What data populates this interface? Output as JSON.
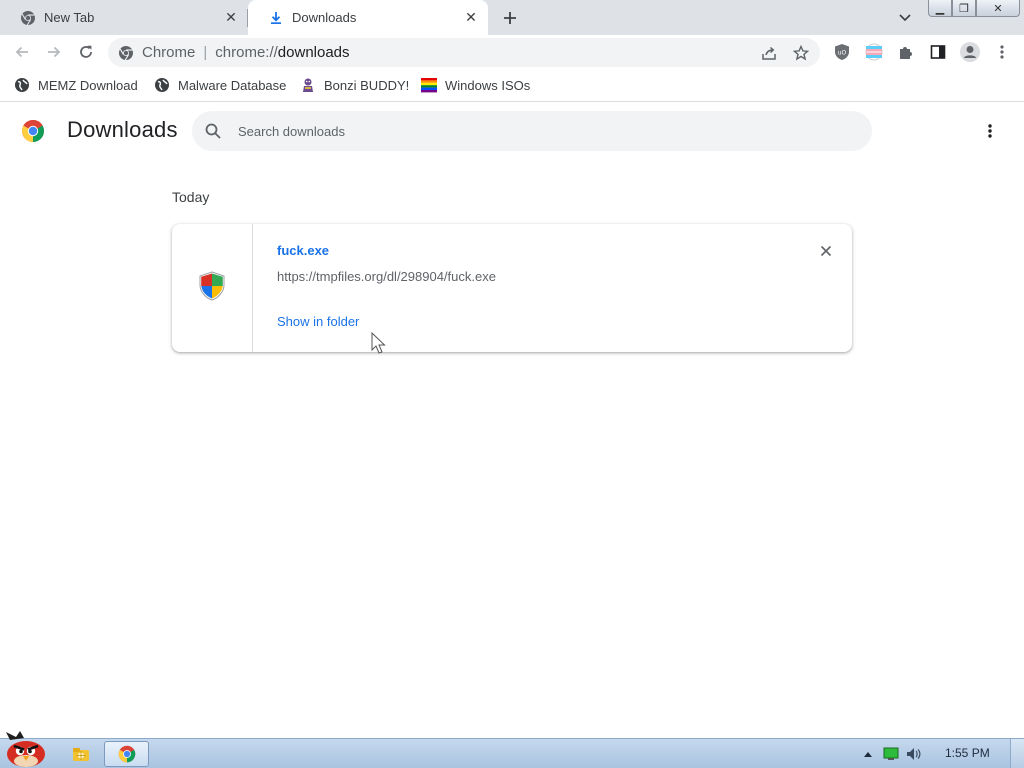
{
  "tabs": [
    {
      "title": "New Tab",
      "icon": "chrome-icon"
    },
    {
      "title": "Downloads",
      "icon": "download-icon",
      "active": true
    }
  ],
  "omnibox": {
    "chip": "Chrome",
    "scheme": "chrome://",
    "path": "downloads"
  },
  "bookmarks": [
    {
      "label": "MEMZ Download",
      "icon": "globe-icon"
    },
    {
      "label": "Malware Database",
      "icon": "globe-icon"
    },
    {
      "label": "Bonzi BUDDY!",
      "icon": "bonzi-icon"
    },
    {
      "label": "Windows ISOs",
      "icon": "rainbow-flag-icon"
    }
  ],
  "page": {
    "title": "Downloads",
    "search_placeholder": "Search downloads",
    "day_header": "Today"
  },
  "download": {
    "filename": "fuck.exe",
    "url": "https://tmpfiles.org/dl/298904/fuck.exe",
    "action": "Show in folder"
  },
  "taskbar": {
    "time": "1:55 PM"
  },
  "colors": {
    "accent": "#1a73e8",
    "tabstrip": "#dee1e6",
    "omnibox": "#f1f3f4"
  }
}
